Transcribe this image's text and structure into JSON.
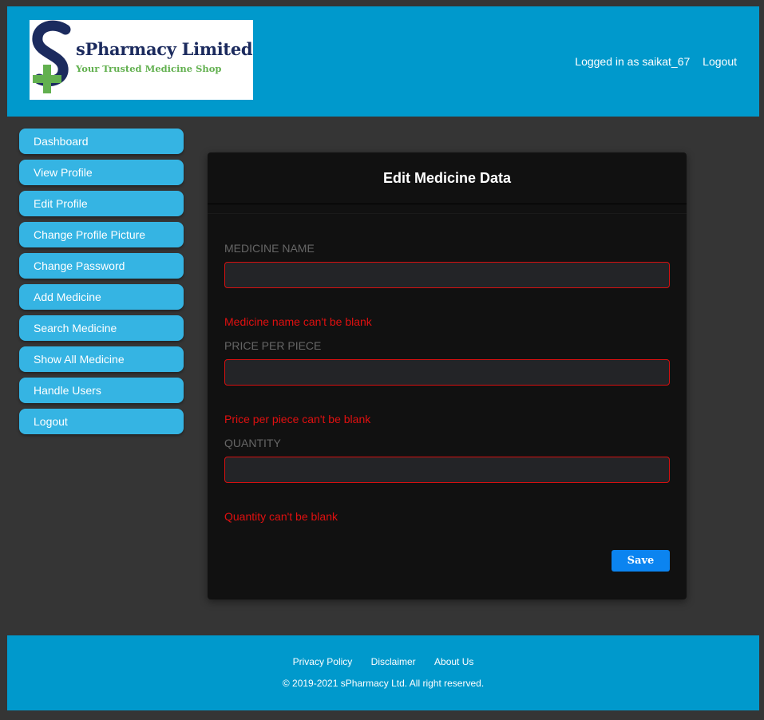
{
  "header": {
    "brand": "sPharmacy Limited",
    "tagline": "Your Trusted Medicine Shop",
    "logged_in_text": "Logged in as saikat_67",
    "logout_label": "Logout",
    "colors": {
      "bar": "#0099cc",
      "logo_navy": "#1c2b5e",
      "logo_green": "#62b04f"
    }
  },
  "sidebar": {
    "items": [
      {
        "label": "Dashboard"
      },
      {
        "label": "View Profile"
      },
      {
        "label": "Edit Profile"
      },
      {
        "label": "Change Profile Picture"
      },
      {
        "label": "Change Password"
      },
      {
        "label": "Add Medicine"
      },
      {
        "label": "Search Medicine"
      },
      {
        "label": "Show All Medicine"
      },
      {
        "label": "Handle Users"
      },
      {
        "label": "Logout"
      }
    ]
  },
  "form": {
    "title": "Edit Medicine Data",
    "fields": [
      {
        "label": "MEDICINE NAME",
        "value": "",
        "error": "Medicine name can't be blank"
      },
      {
        "label": "PRICE PER PIECE",
        "value": "",
        "error": "Price per piece can't be blank"
      },
      {
        "label": "QUANTITY",
        "value": "",
        "error": "Quantity can't be blank"
      }
    ],
    "save_label": "Save",
    "colors": {
      "error": "#e01010",
      "save": "#0b84f0"
    }
  },
  "footer": {
    "links": [
      "Privacy Policy",
      "Disclaimer",
      "About Us"
    ],
    "copyright": "© 2019-2021 sPharmacy Ltd. All right reserved."
  }
}
